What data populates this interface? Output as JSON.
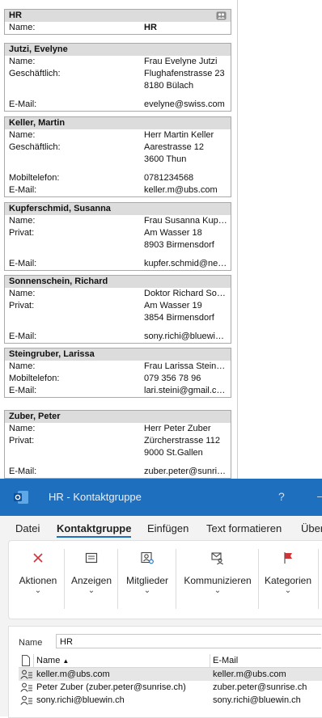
{
  "cards": [
    {
      "header": "HR",
      "group": true,
      "rows": [
        {
          "label": "Name:",
          "value": "HR",
          "bold": true
        }
      ]
    },
    {
      "header": "Jutzi, Evelyne",
      "rows": [
        {
          "label": "Name:",
          "value": "Frau Evelyne Jutzi"
        },
        {
          "label": "Geschäftlich:",
          "value": "Flughafenstrasse 23",
          "value2": "8180  Bülach"
        },
        {
          "gap": true
        },
        {
          "label": "E-Mail:",
          "value": "evelyne@swiss.com"
        }
      ]
    },
    {
      "header": "Keller, Martin",
      "rows": [
        {
          "label": "Name:",
          "value": "Herr Martin Keller"
        },
        {
          "label": "Geschäftlich:",
          "value": "Aarestrasse 12",
          "value2": "3600  Thun"
        },
        {
          "gap": true
        },
        {
          "label": "Mobiltelefon:",
          "value": "0781234568"
        },
        {
          "label": "E-Mail:",
          "value": "keller.m@ubs.com"
        }
      ]
    },
    {
      "header": "Kupferschmid, Susanna",
      "rows": [
        {
          "label": "Name:",
          "value": "Frau Susanna Kupferschmid"
        },
        {
          "label": "Privat:",
          "value": "Am Wasser 18",
          "value2": "8903  Birmensdorf"
        },
        {
          "gap": true
        },
        {
          "label": "E-Mail:",
          "value": "kupfer.schmid@nettv.ch"
        }
      ]
    },
    {
      "header": "Sonnenschein, Richard",
      "rows": [
        {
          "label": "Name:",
          "value": "Doktor Richard Sonnenschein"
        },
        {
          "label": "Privat:",
          "value": "Am Wasser 19",
          "value2": "3854  Birmensdorf"
        },
        {
          "gap": true
        },
        {
          "label": "E-Mail:",
          "value": "sony.richi@bluewin.ch"
        }
      ]
    },
    {
      "header": "Steingruber, Larissa",
      "rows": [
        {
          "label": "Name:",
          "value": "Frau Larissa Steingruber"
        },
        {
          "label": "Mobiltelefon:",
          "value": "079 356 78 96"
        },
        {
          "label": "E-Mail:",
          "value": "lari.steini@gmail.com"
        }
      ]
    },
    {
      "header": "Zuber, Peter",
      "rows": [
        {
          "label": "Name:",
          "value": "Herr Peter Zuber"
        },
        {
          "label": "Privat:",
          "value": "Zürcherstrasse 112",
          "value2": "9000  St.Gallen"
        },
        {
          "gap": true
        },
        {
          "label": "E-Mail:",
          "value": "zuber.peter@sunrise.ch"
        }
      ]
    }
  ],
  "window": {
    "title": "HR  -  Kontaktgruppe",
    "help": "?",
    "minimize": "–",
    "tabs": [
      "Datei",
      "Kontaktgruppe",
      "Einfügen",
      "Text formatieren",
      "Über"
    ],
    "active_tab": "Kontaktgruppe",
    "ribbon": [
      {
        "label": "Aktionen",
        "icon": "x-icon"
      },
      {
        "label": "Anzeigen",
        "icon": "view-icon"
      },
      {
        "label": "Mitglieder",
        "icon": "members-icon"
      },
      {
        "label": "Kommunizieren",
        "icon": "communicate-icon"
      },
      {
        "label": "Kategorien",
        "icon": "flag-icon"
      }
    ],
    "chevron": "⌄",
    "name_label": "Name",
    "name_value": "HR",
    "list": {
      "col_name": "Name",
      "sort_indicator": "▲",
      "col_email": "E-Mail",
      "rows": [
        {
          "name": "keller.m@ubs.com",
          "email": "keller.m@ubs.com",
          "selected": true
        },
        {
          "name": "Peter Zuber (zuber.peter@sunrise.ch)",
          "email": "zuber.peter@sunrise.ch"
        },
        {
          "name": "sony.richi@bluewin.ch",
          "email": "sony.richi@bluewin.ch"
        }
      ]
    },
    "colors": {
      "titlebar": "#1f6fbf",
      "flag": "#d13438",
      "x": "#d13438"
    }
  }
}
